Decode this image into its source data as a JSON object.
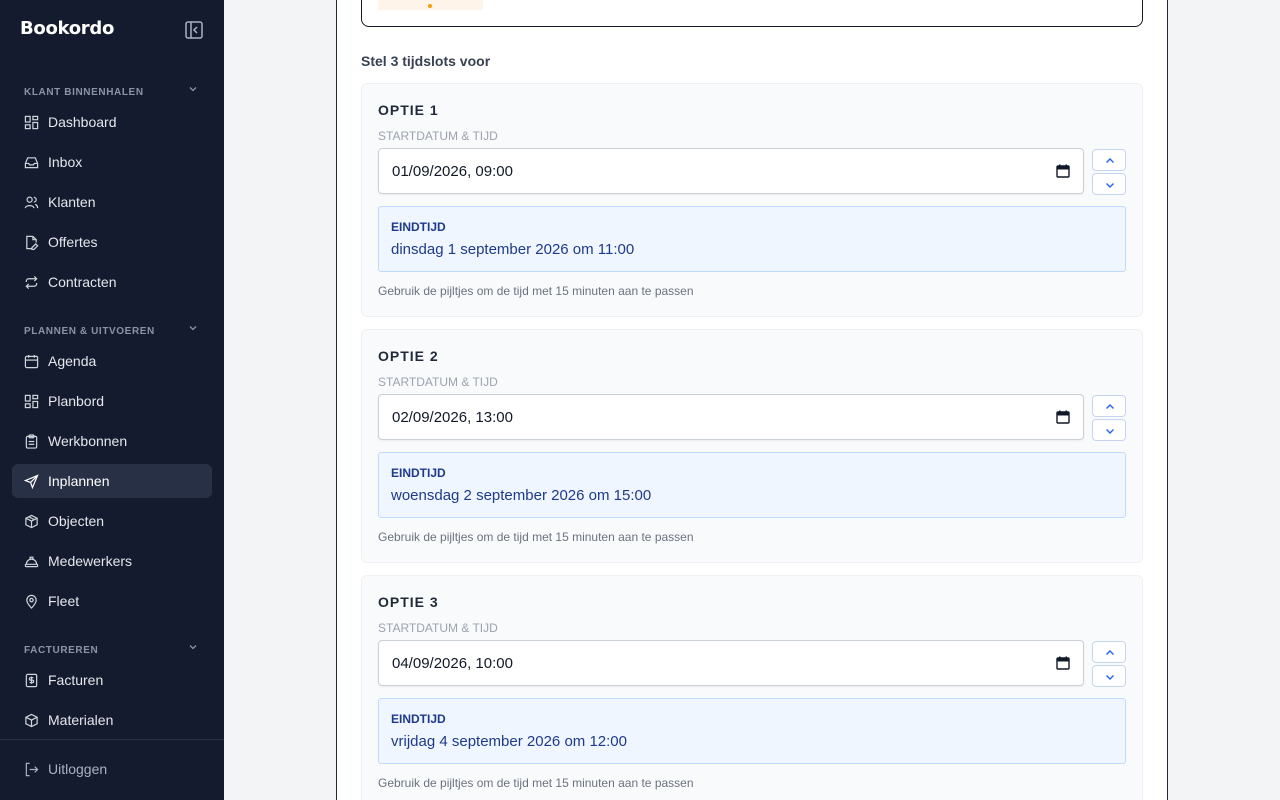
{
  "app": {
    "name": "Bookordo"
  },
  "sidebar": {
    "sections": [
      {
        "label": "KLANT BINNENHALEN",
        "items": [
          {
            "label": "Dashboard",
            "icon": "grid-icon"
          },
          {
            "label": "Inbox",
            "icon": "inbox-icon"
          },
          {
            "label": "Klanten",
            "icon": "users-icon"
          },
          {
            "label": "Offertes",
            "icon": "file-edit-icon"
          },
          {
            "label": "Contracten",
            "icon": "repeat-icon"
          }
        ]
      },
      {
        "label": "PLANNEN & UITVOEREN",
        "items": [
          {
            "label": "Agenda",
            "icon": "calendar-icon"
          },
          {
            "label": "Planbord",
            "icon": "grid-icon"
          },
          {
            "label": "Werkbonnen",
            "icon": "clipboard-icon"
          },
          {
            "label": "Inplannen",
            "icon": "send-icon",
            "active": true
          },
          {
            "label": "Objecten",
            "icon": "boxes-icon"
          },
          {
            "label": "Medewerkers",
            "icon": "hardhat-icon"
          },
          {
            "label": "Fleet",
            "icon": "map-pin-icon"
          }
        ]
      },
      {
        "label": "FACTUREREN",
        "items": [
          {
            "label": "Facturen",
            "icon": "receipt-icon"
          },
          {
            "label": "Materialen",
            "icon": "package-icon"
          }
        ]
      }
    ],
    "logout": {
      "label": "Uitloggen",
      "icon": "logout-icon"
    }
  },
  "main": {
    "suggest_label": "Stel 3 tijdslots voor",
    "options": [
      {
        "title": "OPTIE 1",
        "start_label": "STARTDATUM & TIJD",
        "start_value": "01/09/2026, 09:00",
        "end_label": "EINDTIJD",
        "end_value": "dinsdag 1 september 2026 om 11:00",
        "hint": "Gebruik de pijltjes om de tijd met 15 minuten aan te passen"
      },
      {
        "title": "OPTIE 2",
        "start_label": "STARTDATUM & TIJD",
        "start_value": "02/09/2026, 13:00",
        "end_label": "EINDTIJD",
        "end_value": "woensdag 2 september 2026 om 15:00",
        "hint": "Gebruik de pijltjes om de tijd met 15 minuten aan te passen"
      },
      {
        "title": "OPTIE 3",
        "start_label": "STARTDATUM & TIJD",
        "start_value": "04/09/2026, 10:00",
        "end_label": "EINDTIJD",
        "end_value": "vrijdag 4 september 2026 om 12:00",
        "hint": "Gebruik de pijltjes om de tijd met 15 minuten aan te passen"
      }
    ]
  },
  "colors": {
    "sidebar_bg": "#141b2e",
    "active_item_bg": "#283045",
    "end_box_bg": "#eff6ff",
    "end_text": "#1e3a8a"
  }
}
